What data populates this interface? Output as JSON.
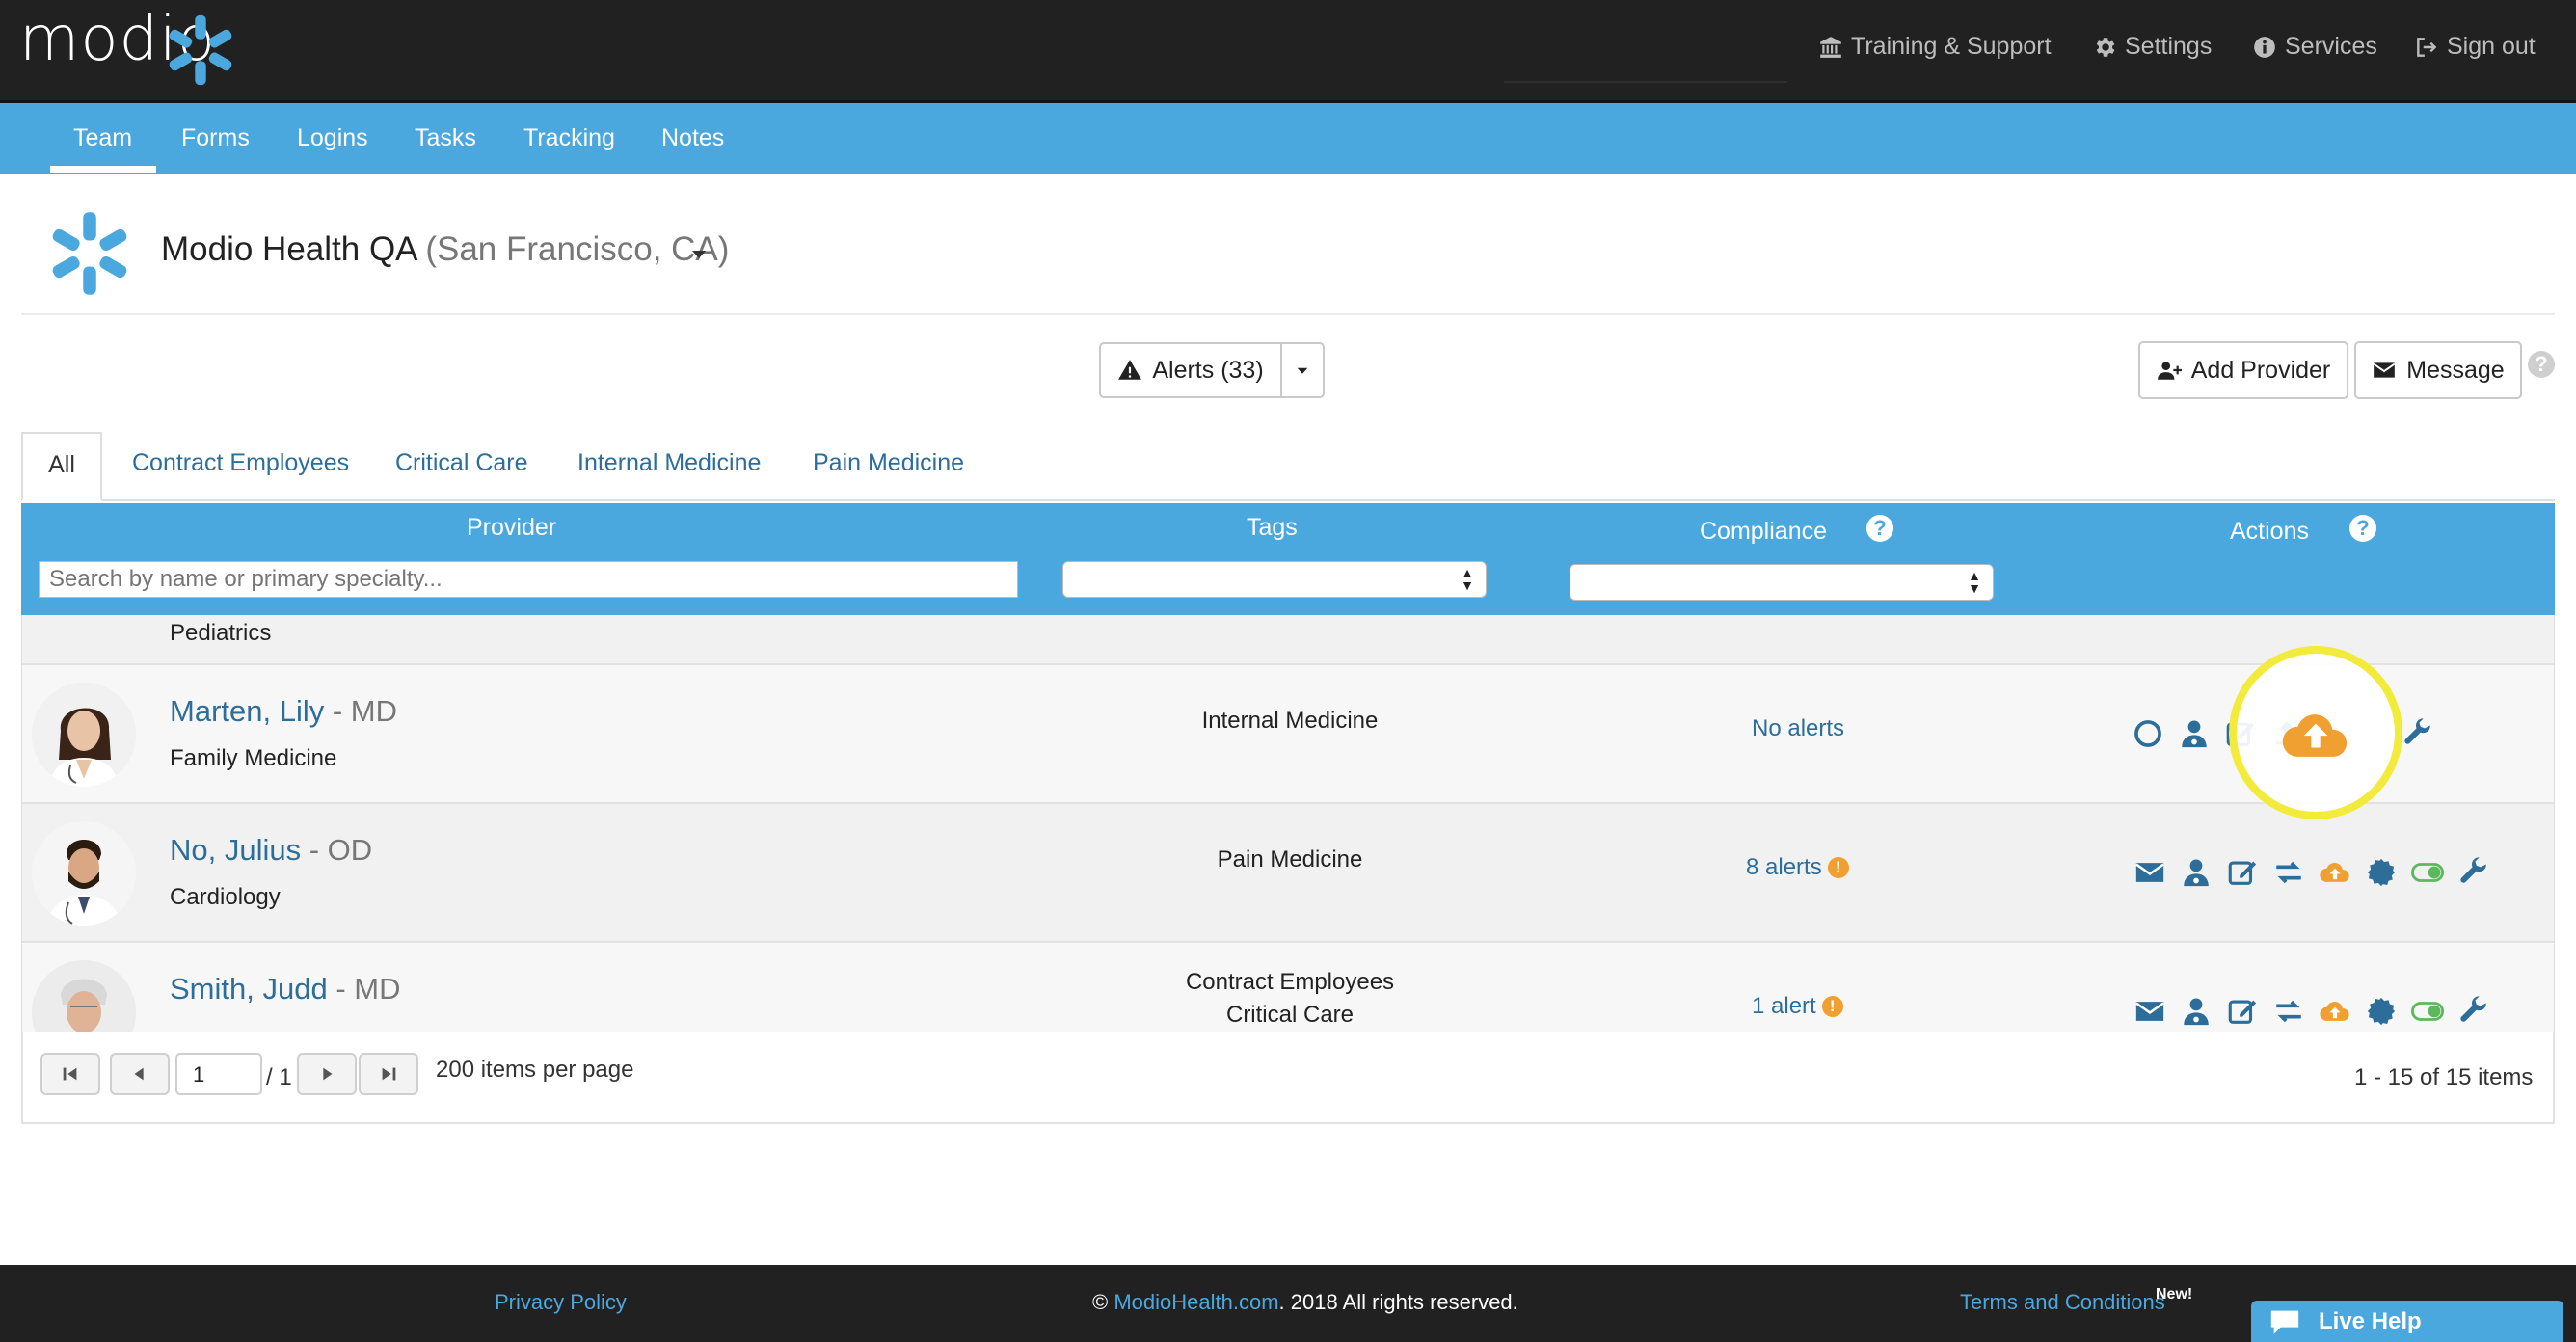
{
  "app": {
    "logo_text": "modio",
    "top_links": [
      {
        "label": "Training & Support",
        "icon": "bank-icon"
      },
      {
        "label": "Settings",
        "icon": "gear-icon"
      },
      {
        "label": "Services",
        "icon": "info-icon"
      },
      {
        "label": "Sign out",
        "icon": "sign-out-icon"
      }
    ]
  },
  "nav": {
    "tabs": [
      "Team",
      "Forms",
      "Logins",
      "Tasks",
      "Tracking",
      "Notes"
    ],
    "active": "Team"
  },
  "org": {
    "name": "Modio Health QA",
    "location": "(San Francisco, CA)"
  },
  "toolbar": {
    "alerts_label": "Alerts (33)",
    "add_provider_label": "Add Provider",
    "message_label": "Message"
  },
  "filter_tabs": [
    "All",
    "Contract Employees",
    "Critical Care",
    "Internal Medicine",
    "Pain Medicine"
  ],
  "grid": {
    "columns": {
      "provider": "Provider",
      "tags": "Tags",
      "compliance": "Compliance",
      "actions": "Actions"
    },
    "search_placeholder": "Search by name or primary specialty...",
    "partial_row_specialty": "Pediatrics",
    "rows": [
      {
        "name": "Marten, Lily",
        "credential": "- MD",
        "specialty": "Family Medicine",
        "tags": [
          "Internal Medicine"
        ],
        "compliance": "No alerts",
        "has_alert_icon": false
      },
      {
        "name": "No, Julius",
        "credential": "- OD",
        "specialty": "Cardiology",
        "tags": [
          "Pain Medicine"
        ],
        "compliance": "8 alerts",
        "has_alert_icon": true
      },
      {
        "name": "Smith, Judd",
        "credential": "- MD",
        "specialty": "",
        "tags": [
          "Contract Employees",
          "Critical Care"
        ],
        "compliance": "1 alert",
        "has_alert_icon": true
      }
    ]
  },
  "pager": {
    "page": "1",
    "of": "/ 1",
    "per_page_label": "200 items per page",
    "summary": "1 - 15 of 15 items"
  },
  "footer": {
    "privacy": "Privacy Policy",
    "copyright_symbol": "©",
    "copyright_link": "ModioHealth.com",
    "copyright_rest": ". 2018 All rights reserved.",
    "terms": "Terms and Conditions",
    "new_badge": "New!",
    "live_help": "Live Help"
  },
  "colors": {
    "topbar": "#212121",
    "nav_blue": "#4aa8df",
    "link_blue": "#2d6d99",
    "upload_orange": "#f0a030",
    "action_blue": "#2d6d99",
    "toggle_green": "#5cb85c",
    "highlight_yellow": "#f2eb3c"
  }
}
